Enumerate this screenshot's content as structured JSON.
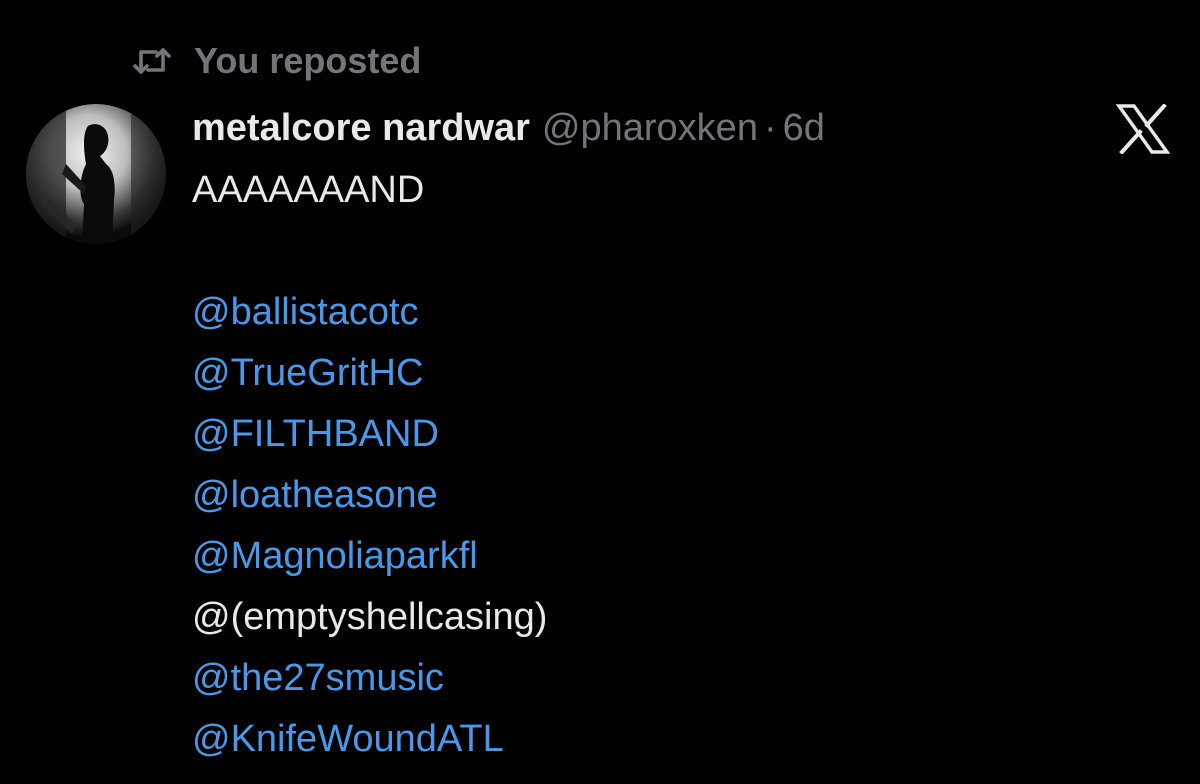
{
  "repost": {
    "label": "You reposted",
    "icon": "repost-icon"
  },
  "tweet": {
    "display_name": "metalcore nardwar",
    "handle": "@pharoxken",
    "separator": "·",
    "timestamp": "6d",
    "text_first": "AAAAAAAND",
    "mentions": [
      "@ballistacotc",
      "@TrueGritHC",
      "@FILTHBAND",
      "@loatheasone",
      "@Magnoliaparkfl",
      "@(emptyshellcasing)",
      "@the27smusic",
      "@KnifeWoundATL"
    ]
  },
  "colors": {
    "background": "#000000",
    "primary_text": "#e7e9ea",
    "secondary_text": "#71767b",
    "link": "#4a99e9"
  },
  "brand_icon": "x-logo-icon"
}
